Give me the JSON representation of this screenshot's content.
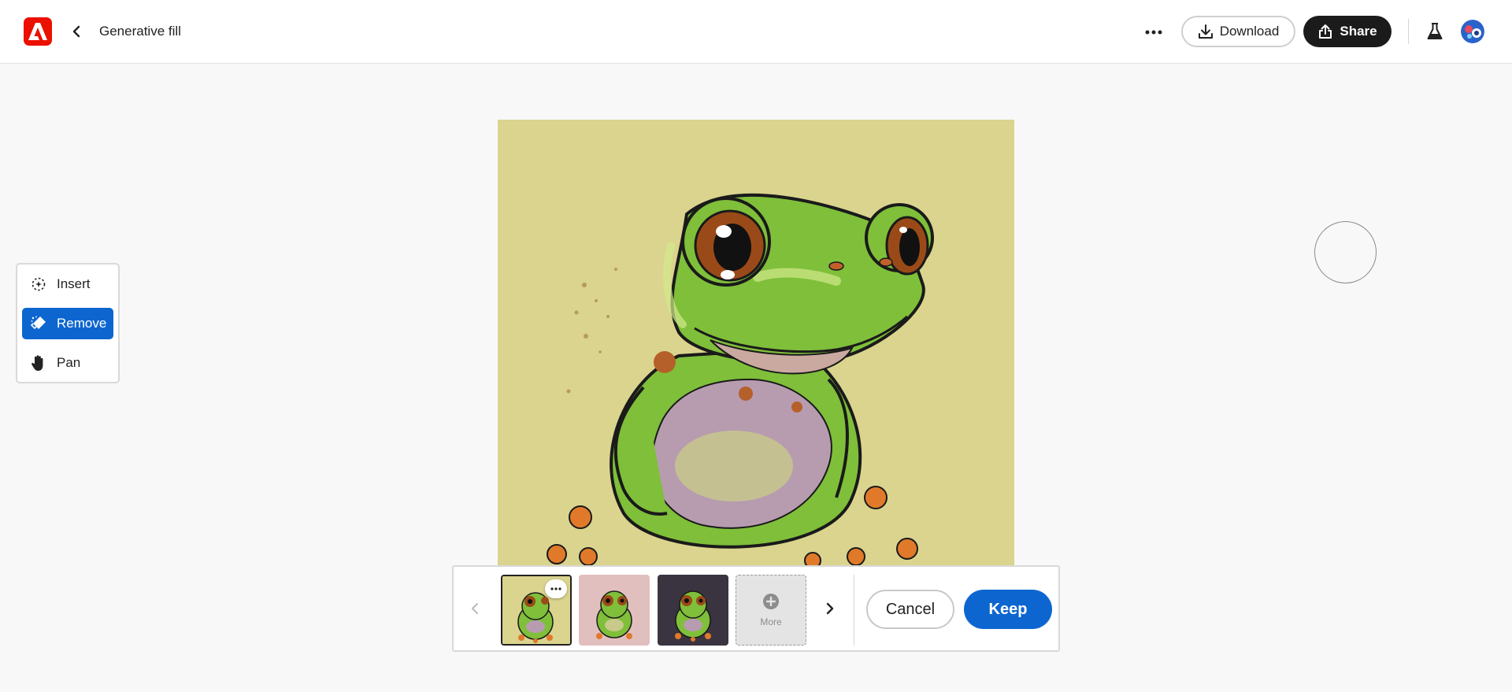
{
  "header": {
    "title": "Generative fill",
    "download_label": "Download",
    "share_label": "Share",
    "logo_icon": "adobe-logo-icon",
    "back_icon": "chevron-left-icon",
    "more_icon": "ellipsis-icon",
    "beaker_icon": "beaker-icon"
  },
  "tools": {
    "items": [
      {
        "label": "Insert",
        "icon": "insert-sparkle-icon",
        "active": false
      },
      {
        "label": "Remove",
        "icon": "remove-eraser-icon",
        "active": true
      },
      {
        "label": "Pan",
        "icon": "hand-icon",
        "active": false
      }
    ]
  },
  "variations": {
    "more_label": "More",
    "selected_index": 0,
    "thumbnail_backgrounds": [
      "#dad48e",
      "#e2bfbf",
      "#3a3440"
    ]
  },
  "actions": {
    "cancel_label": "Cancel",
    "keep_label": "Keep"
  },
  "colors": {
    "accent": "#0d66d0",
    "adobe_red": "#eb1000",
    "canvas_background": "#dad48e"
  }
}
